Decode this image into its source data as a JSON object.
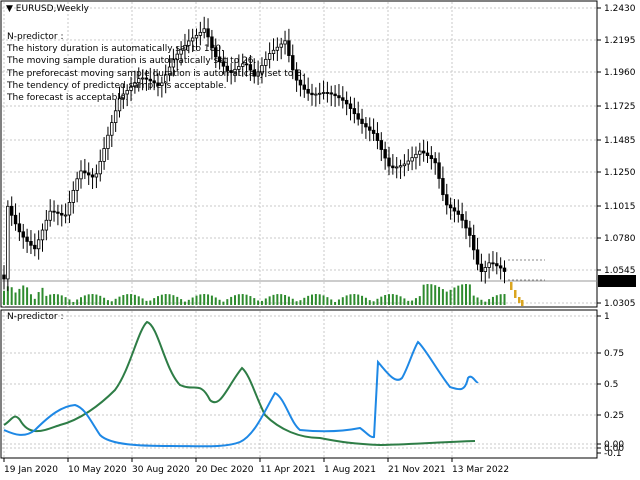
{
  "chart": {
    "symbol_label": "EURUSD,Weekly",
    "current_price": "1.0471",
    "price_axis": [
      "1.2430",
      "1.2195",
      "1.1960",
      "1.1725",
      "1.1485",
      "1.1250",
      "1.1015",
      "1.0780",
      "1.0545",
      "1.0305"
    ],
    "indicator_axis": [
      "1",
      "0.75",
      "0.5",
      "0.25",
      "0.00",
      "0.00",
      "-0.1"
    ],
    "time_axis": [
      "19 Jan 2020",
      "10 May 2020",
      "30 Aug 2020",
      "20 Dec 2020",
      "11 Apr 2021",
      "1 Aug 2021",
      "21 Nov 2021",
      "13 Mar 2022"
    ]
  },
  "info": {
    "title": "N-predictor :",
    "lines": [
      "The history duration is automatically set to 180.",
      "The moving sample duration is automatically set to 26.",
      "The preforecast moving sample duration is automatically set to 8.",
      "The tendency of predicted sample is acceptable.",
      "The forecast is acceptable."
    ]
  },
  "indicator": {
    "title": "N-predictor :"
  },
  "colors": {
    "bull_candle": "#000000",
    "forecast": "#daa520",
    "volume": "#2e8b2e",
    "line_green": "#2e7d46",
    "line_blue": "#1e88e5",
    "grid": "#c8c8c8",
    "price_label_bg": "#000000"
  },
  "icons": {
    "symbol_dropdown": "triangle-down-icon"
  }
}
